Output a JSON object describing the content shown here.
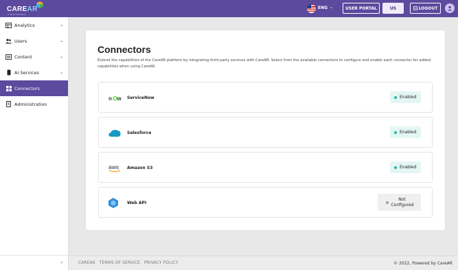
{
  "topbar": {
    "logo": "CARE",
    "logo_accent": "AR",
    "logo_sub": "A Xerox Company",
    "language": "ENG",
    "user_portal": "USER PORTAL",
    "region": "US",
    "logout": "LOGOUT",
    "brand_color": "#5b4a9e"
  },
  "sidebar": {
    "items": [
      {
        "label": "Analytics",
        "icon": "analytics-icon",
        "has_chevron": true
      },
      {
        "label": "Users",
        "icon": "users-icon",
        "has_chevron": true
      },
      {
        "label": "Content",
        "icon": "content-icon",
        "has_chevron": true
      },
      {
        "label": "AI Services",
        "icon": "ai-icon",
        "has_chevron": true
      },
      {
        "label": "Connectors",
        "icon": "grid-icon",
        "active": true
      },
      {
        "label": "Administration",
        "icon": "admin-icon"
      }
    ],
    "collapse_icon": "chevron-left-icon"
  },
  "main": {
    "title": "Connectors",
    "description": "Extend the capabilities of the CareAR platform by integrating third party services with CareAR. Select from the available connectors to configure and enable each connector for added capabilities when using CareAR.",
    "connectors": [
      {
        "name": "ServiceNow",
        "status": "Enabled",
        "icon": "servicenow-icon"
      },
      {
        "name": "Salesforce",
        "status": "Enabled",
        "icon": "salesforce-icon"
      },
      {
        "name": "Amazon S3",
        "status": "Enabled",
        "icon": "aws-icon"
      },
      {
        "name": "Web API",
        "status": "Not Configured",
        "icon": "webapi-icon"
      }
    ]
  },
  "footer": {
    "links": [
      "CAREAR",
      "TERMS OF SERVICE",
      "PRIVACY POLICY"
    ],
    "copyright": "© 2022, Powered by CareAR"
  }
}
